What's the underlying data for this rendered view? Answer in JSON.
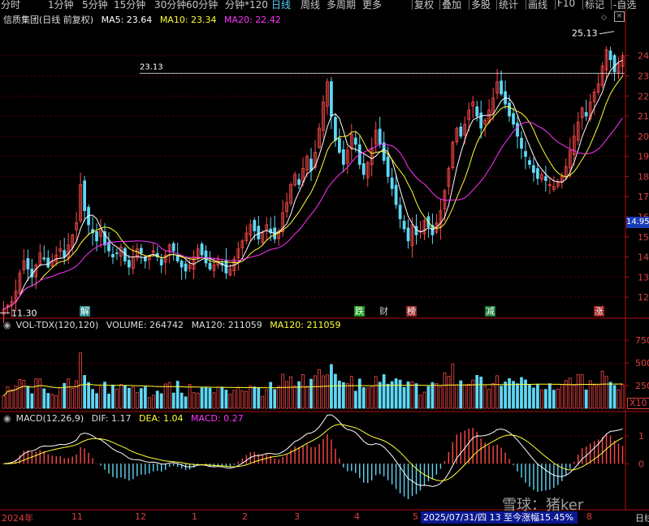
{
  "toolbar": {
    "items": [
      "分时",
      "1分钟",
      "5分钟",
      "15分钟",
      "30分钟",
      "60分钟",
      "分钟*120",
      "日线",
      "周线",
      "多周期",
      "更多"
    ],
    "active": "日线",
    "right_items": [
      "复权",
      "叠加",
      "多股",
      "统计",
      "画线",
      "F10",
      "标记",
      "-自选"
    ]
  },
  "price_header": {
    "title": "信质集团(日线 前复权)",
    "ma5": "MA5: 23.64",
    "ma10": "MA10: 23.34",
    "ma20": "MA20: 22.42"
  },
  "volume_header": {
    "name": "VOL-TDX(120,120)",
    "volume": "VOLUME: 264742",
    "ma120a": "MA120: 211059",
    "ma120b": "MA120: 211059"
  },
  "macd_header": {
    "name": "MACD(12,26,9)",
    "dif": "DIF: 1.17",
    "dea": "DEA: 1.04",
    "macd": "MACD: 0.27"
  },
  "annotations": {
    "high_line_label": "23.13",
    "max_label": "25.13",
    "min_label": "11.30",
    "current_price_tag": "14.95",
    "vol_unit": "X10",
    "markers": [
      {
        "text": "解",
        "color": "#2a8a8a"
      },
      {
        "text": "跌",
        "color": "#1a9a1a"
      },
      {
        "text": "财",
        "color": "#2a2a8a"
      },
      {
        "text": "榜",
        "color": "#9a2a2a"
      },
      {
        "text": "减",
        "color": "#1a7a3a"
      },
      {
        "text": "涨",
        "color": "#9a1a1a"
      }
    ]
  },
  "x_axis": {
    "labels": [
      "2024年",
      "11",
      "12",
      "1",
      "2",
      "3",
      "4",
      "5",
      "8",
      "日线"
    ],
    "cursor_box": "2025/07/31/四 13 至今涨幅15.45%"
  },
  "watermark": "雪球：猪ker",
  "colors": {
    "up": "#ff4a4a",
    "down": "#5fd7f5",
    "ma5": "#ffffff",
    "ma10": "#ffff33",
    "ma20": "#ff33ff",
    "axis": "#b01010"
  },
  "chart_data": [
    {
      "type": "candlestick",
      "title": "信质集团(日线 前复权)",
      "y_ticks": [
        12,
        13,
        14,
        15,
        16,
        17,
        18,
        19,
        20,
        21,
        22,
        23,
        24
      ],
      "ylim": [
        11.2,
        25.4
      ],
      "reference_line": 23.13,
      "period": "daily, 2024-10 to 2025-08",
      "key_points": {
        "low": 11.3,
        "high": 25.13
      },
      "closes_approx": [
        11.4,
        11.6,
        11.8,
        12.3,
        13.2,
        13.8,
        13.4,
        13.0,
        13.6,
        14.2,
        13.9,
        13.5,
        13.8,
        14.1,
        14.4,
        14.0,
        14.6,
        15.1,
        15.7,
        17.6,
        16.3,
        15.6,
        15.2,
        14.8,
        15.4,
        14.6,
        14.3,
        14.0,
        14.2,
        14.5,
        13.8,
        13.5,
        14.0,
        14.4,
        14.2,
        13.8,
        14.0,
        14.3,
        14.0,
        13.6,
        14.1,
        14.6,
        14.3,
        13.8,
        13.5,
        13.3,
        13.6,
        14.0,
        14.4,
        14.1,
        13.7,
        13.4,
        13.6,
        13.9,
        13.6,
        13.2,
        13.4,
        13.9,
        14.4,
        14.8,
        15.2,
        15.6,
        15.3,
        14.9,
        15.2,
        15.6,
        15.2,
        14.9,
        15.3,
        16.2,
        16.7,
        17.6,
        18.1,
        17.6,
        18.4,
        19.0,
        18.3,
        19.2,
        20.4,
        21.7,
        22.7,
        21.0,
        19.8,
        19.2,
        18.6,
        19.3,
        20.1,
        19.6,
        18.6,
        18.1,
        18.7,
        19.4,
        20.3,
        19.6,
        18.8,
        18.0,
        17.4,
        16.6,
        15.9,
        15.4,
        14.8,
        15.6,
        15.1,
        15.3,
        15.8,
        15.5,
        15.1,
        15.7,
        16.3,
        17.3,
        18.4,
        19.7,
        20.4,
        20.0,
        20.6,
        21.3,
        21.7,
        21.0,
        20.4,
        20.8,
        21.3,
        21.9,
        22.7,
        22.1,
        21.6,
        21.0,
        20.6,
        20.0,
        19.4,
        19.0,
        18.6,
        18.2,
        17.9,
        18.1,
        17.8,
        17.6,
        17.5,
        17.7,
        18.0,
        18.5,
        19.3,
        20.0,
        20.7,
        21.4,
        21.0,
        21.7,
        22.2,
        22.6,
        23.5,
        24.3,
        23.8,
        23.2,
        23.6,
        24.0
      ]
    },
    {
      "type": "bar",
      "title": "VOL-TDX(120,120)",
      "y_ticks": [
        250,
        500,
        750
      ],
      "unit": "X10",
      "series": [
        {
          "name": "VOLUME",
          "last": 264742
        },
        {
          "name": "MA120",
          "last": 211059
        }
      ]
    },
    {
      "type": "bar",
      "title": "MACD(12,26,9)",
      "y_ticks": [
        0,
        1
      ],
      "series": [
        {
          "name": "DIF",
          "last": 1.17
        },
        {
          "name": "DEA",
          "last": 1.04
        },
        {
          "name": "MACD",
          "last": 0.27
        }
      ]
    }
  ]
}
